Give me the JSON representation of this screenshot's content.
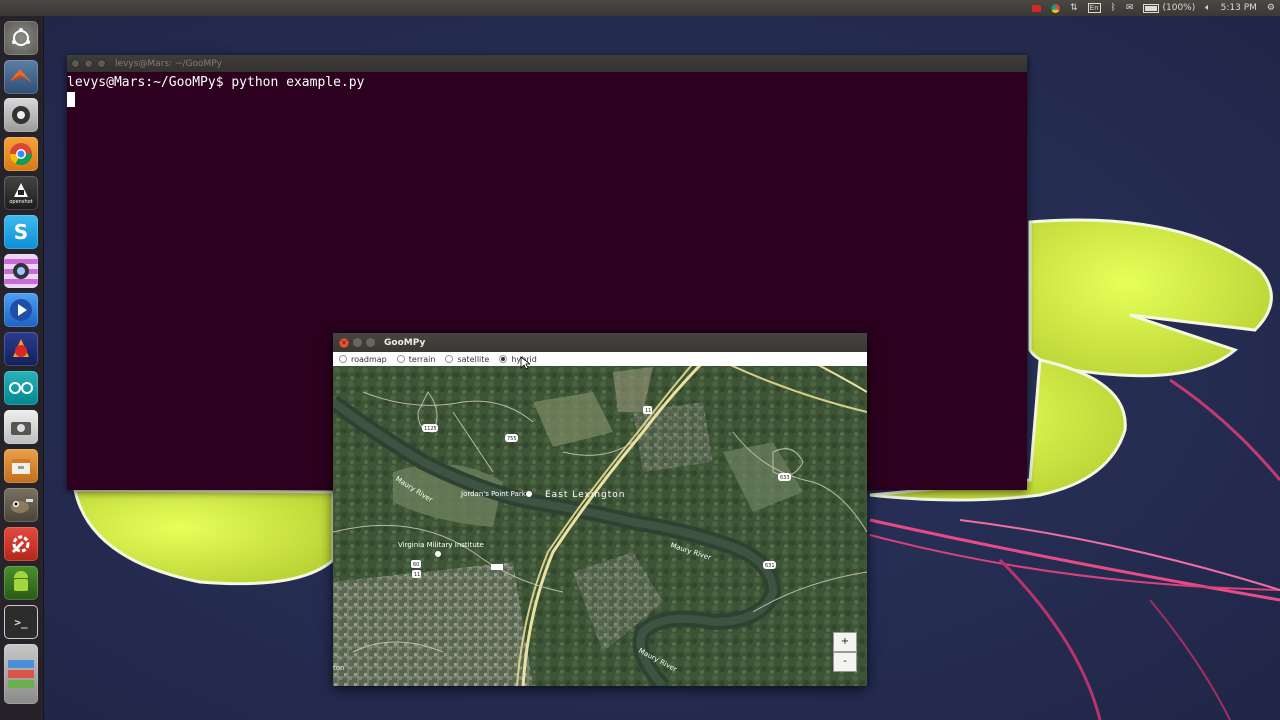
{
  "top_panel": {
    "keyboard_layout": "En",
    "battery": "(100%)",
    "clock": "5:13 PM"
  },
  "launcher": {
    "items": [
      {
        "icon": "dash-icon"
      },
      {
        "icon": "matlab-icon"
      },
      {
        "icon": "webcam-icon"
      },
      {
        "icon": "chrome-icon"
      },
      {
        "icon": "openshot-icon",
        "label": "openshot"
      },
      {
        "icon": "skype-icon"
      },
      {
        "icon": "camera-app-icon"
      },
      {
        "icon": "media-player-icon"
      },
      {
        "icon": "vlc-like-icon"
      },
      {
        "icon": "arduino-icon"
      },
      {
        "icon": "screenshot-icon"
      },
      {
        "icon": "files-icon"
      },
      {
        "icon": "gimp-icon"
      },
      {
        "icon": "settings-icon"
      },
      {
        "icon": "android-icon"
      },
      {
        "icon": "terminal-icon"
      },
      {
        "icon": "stacked-apps-icon"
      }
    ]
  },
  "terminal": {
    "title": "levys@Mars: ~/GooMPy",
    "prompt_line": "levys@Mars:~/GooMPy$ python example.py",
    "background": "#2c001e"
  },
  "goompy": {
    "title": "GooMPy",
    "radio_options": [
      {
        "label": "roadmap",
        "selected": false
      },
      {
        "label": "terrain",
        "selected": false
      },
      {
        "label": "satellite",
        "selected": false
      },
      {
        "label": "hybrid",
        "selected": true
      }
    ],
    "map_labels": {
      "maury_river_1": "Maury River",
      "maury_river_2": "Maury River",
      "maury_river_3": "Maury River",
      "jordans_point": "Jordan's Point Park",
      "east_lexington": "East Lexington",
      "vmi": "Virginia Military Institute",
      "route_1125": "1125",
      "route_755": "755",
      "route_11a": "11",
      "route_11b": "11",
      "route_631": "631",
      "route_633": "633",
      "route_60": "60",
      "edge_text": "ton"
    },
    "zoom_in_label": "+",
    "zoom_out_label": "-"
  }
}
